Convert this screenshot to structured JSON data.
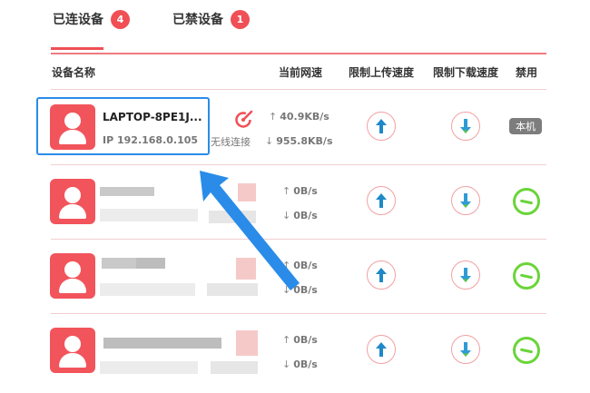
{
  "tabs": [
    {
      "label": "已连设备",
      "count": "4",
      "active": true
    },
    {
      "label": "已禁设备",
      "count": "1",
      "active": false
    }
  ],
  "columns": {
    "device_name": "设备名称",
    "current_speed": "当前网速",
    "limit_upload": "限制上传速度",
    "limit_download": "限制下载速度",
    "disable": "禁用"
  },
  "devices": [
    {
      "name": "LAPTOP-8PE1J...",
      "ip": "IP 192.168.0.105",
      "connection": "无线连接",
      "up_speed": "40.9KB/s",
      "down_speed": "955.8KB/s",
      "badge": "本机"
    },
    {
      "name": "",
      "ip": "",
      "connection": "",
      "up_speed": "0B/s",
      "down_speed": "0B/s"
    },
    {
      "name": "",
      "ip": "",
      "connection": "",
      "up_speed": "0B/s",
      "down_speed": "0B/s"
    },
    {
      "name": "",
      "ip": "",
      "connection": "",
      "up_speed": "0B/s",
      "down_speed": "0B/s"
    }
  ],
  "icons": {
    "avatar": "user-avatar-icon",
    "wireless": "wireless-connection-icon",
    "upload_limit": "arrow-up-icon",
    "download_limit": "arrow-down-icon",
    "disable": "ban-icon"
  },
  "colors": {
    "accent": "#ef4f55",
    "upload_arrow": "#1e88c8",
    "download_arrow": "#2e9bd6",
    "ban": "#6bd43a",
    "highlight": "#2a8ce8"
  }
}
